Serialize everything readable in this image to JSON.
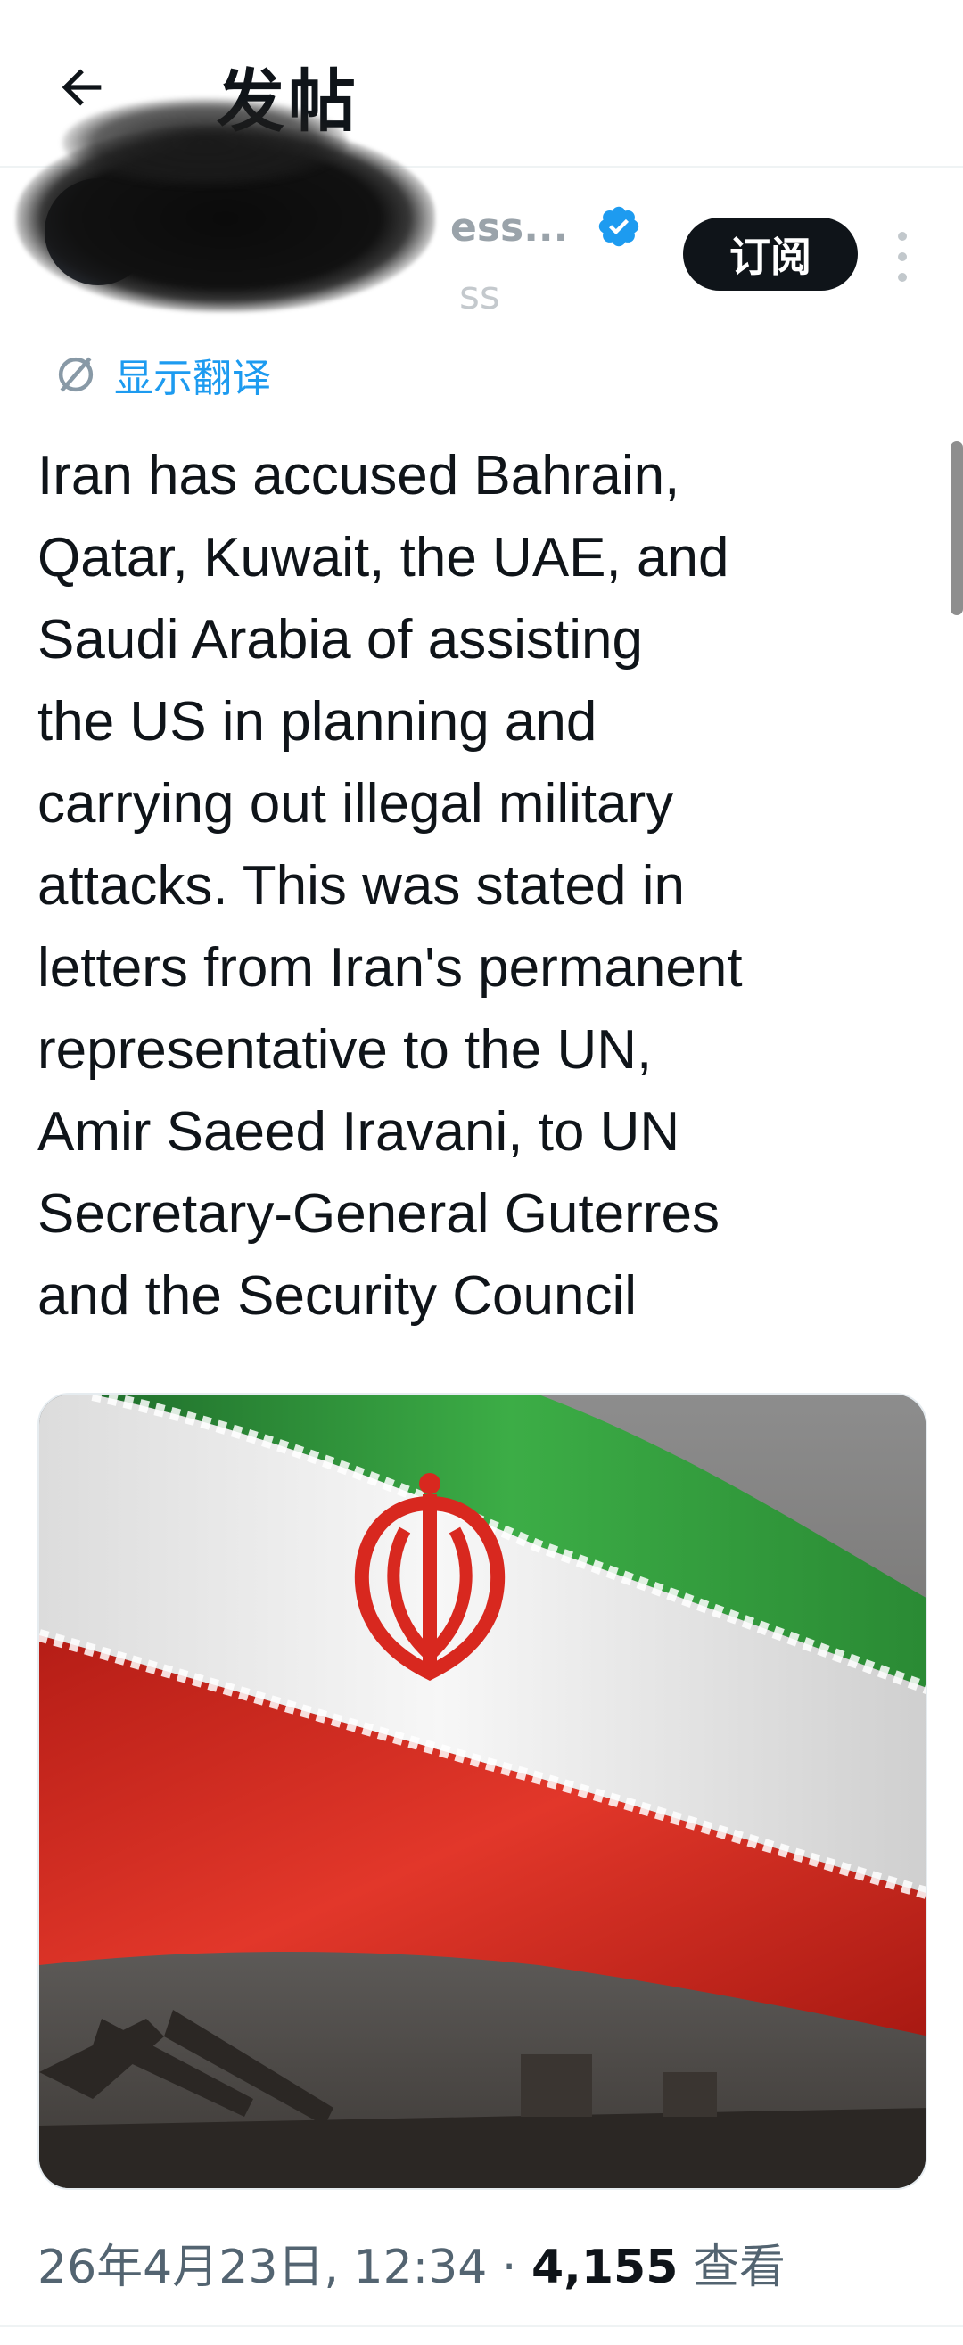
{
  "header": {
    "back_icon": "arrow-left-icon",
    "title": "发帖"
  },
  "author": {
    "display_name": "ess...",
    "handle": "ss",
    "verified_icon": "verified-badge-icon",
    "verified_color": "#1d9bf0",
    "subscribe_label": "订阅",
    "more_icon": "more-vertical-icon"
  },
  "translate": {
    "icon": "translate-icon",
    "label": "显示翻译"
  },
  "tweet": {
    "lines": [
      "Iran has accused Bahrain,",
      "Qatar, Kuwait, the UAE, and",
      "Saudi Arabia of assisting",
      "the US in planning and",
      "carrying out illegal military",
      "attacks. This was stated in",
      "letters from Iran's permanent",
      "representative to the UN,",
      "Amir Saeed Iravani, to UN",
      "Secretary-General Guterres",
      "and the Security Council"
    ]
  },
  "media": {
    "kind": "image of the Iranian flag over missile silhouettes",
    "flag_colors": {
      "green": "#2fa23c",
      "white": "#f2f2f2",
      "red": "#d8281f"
    }
  },
  "meta": {
    "timestamp": "26年4月23日, 12:34",
    "separator": " · ",
    "views_count": "4,155",
    "views_label": " 查看"
  },
  "colors": {
    "accent": "#1d9bf0",
    "text": "#0f1419",
    "muted": "#536471"
  }
}
